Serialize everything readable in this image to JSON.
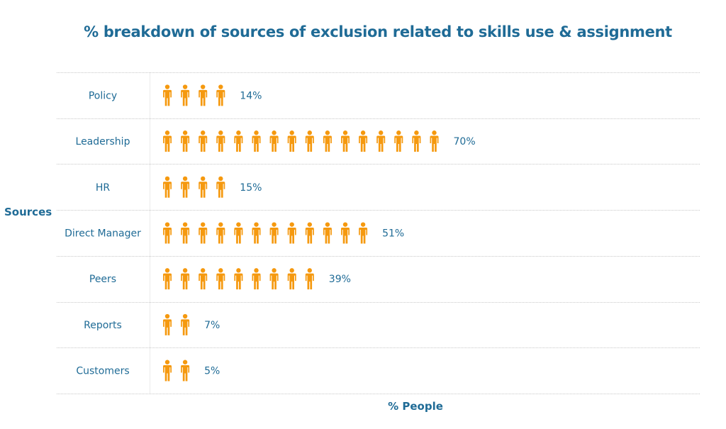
{
  "chart_data": {
    "type": "bar",
    "subtype": "pictogram",
    "title": "% breakdown of sources of exclusion related to skills use & assignment",
    "xlabel": "% People",
    "ylabel": "Sources",
    "categories": [
      "Policy",
      "Leadership",
      "HR",
      "Direct Manager",
      "Peers",
      "Reports",
      "Customers"
    ],
    "values": [
      14,
      70,
      15,
      51,
      39,
      7,
      5
    ],
    "value_labels": [
      "14%",
      "70%",
      "15%",
      "51%",
      "39%",
      "7%",
      "5%"
    ],
    "icon_counts": [
      4,
      16,
      4,
      12,
      9,
      2,
      2
    ],
    "icon": "person-icon",
    "icon_color": "#f5990f",
    "text_color": "#1f6b96",
    "grid": "horizontal-dotted",
    "legend": "none"
  }
}
